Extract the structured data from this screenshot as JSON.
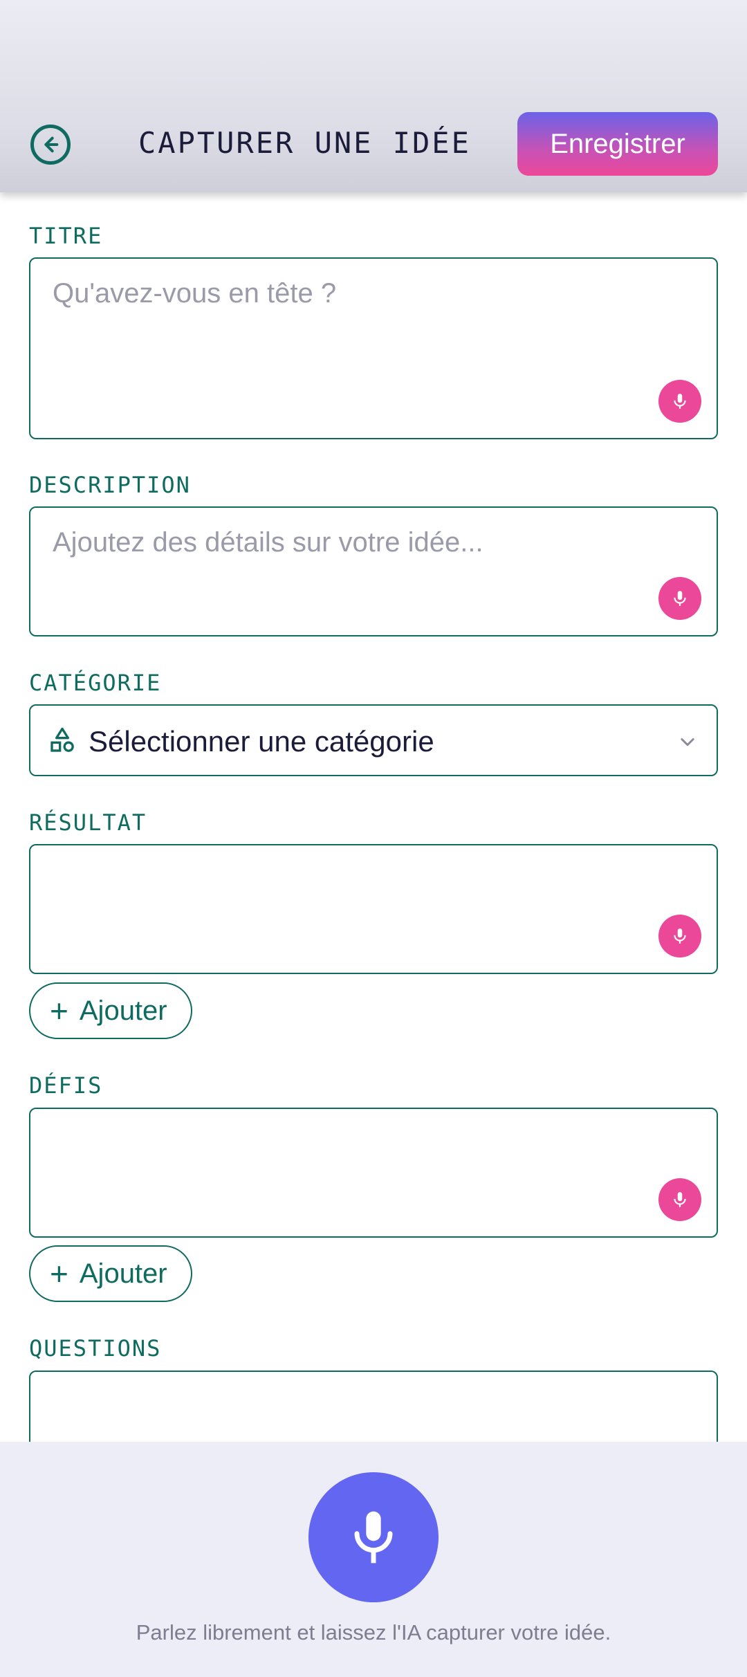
{
  "header": {
    "title": "CAPTURER UNE IDÉE",
    "save_label": "Enregistrer",
    "back_icon": "back-arrow-circle-icon"
  },
  "form": {
    "title": {
      "label": "TITRE",
      "placeholder": "Qu'avez-vous en tête ?"
    },
    "description": {
      "label": "DESCRIPTION",
      "placeholder": "Ajoutez des détails sur votre idée..."
    },
    "category": {
      "label": "CATÉGORIE",
      "value": "Sélectionner une catégorie"
    },
    "result": {
      "label": "RÉSULTAT",
      "add_label": "Ajouter"
    },
    "challenges": {
      "label": "DÉFIS",
      "add_label": "Ajouter"
    },
    "questions": {
      "label": "QUESTIONS"
    }
  },
  "voice": {
    "hint": "Parlez librement et laissez l'IA capturer votre idée."
  },
  "colors": {
    "accent_teal": "#0f6b5f",
    "mic_pink": "#ec4899",
    "mic_primary": "#6366f1",
    "title_text": "#1b1b3a"
  }
}
